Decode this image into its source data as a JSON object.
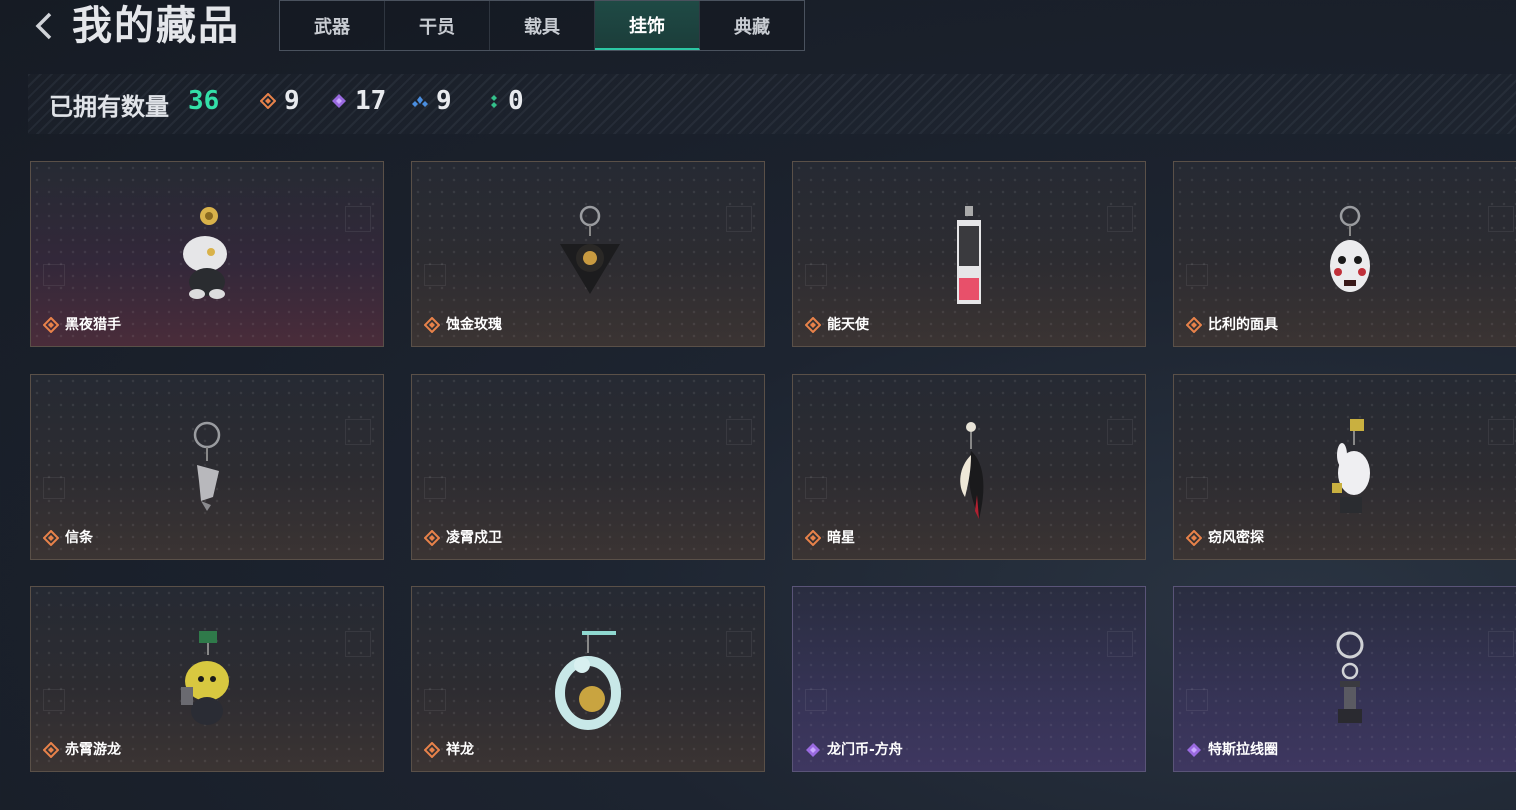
{
  "header": {
    "title": "我的藏品",
    "tabs": [
      {
        "label": "武器",
        "active": false
      },
      {
        "label": "干员",
        "active": false
      },
      {
        "label": "载具",
        "active": false
      },
      {
        "label": "挂饰",
        "active": true
      },
      {
        "label": "典藏",
        "active": false
      }
    ]
  },
  "stats": {
    "label": "已拥有数量",
    "total": "36",
    "orange_count": "9",
    "purple_count": "17",
    "blue_count": "9",
    "green_count": "0"
  },
  "colors": {
    "accent": "#33e0a8",
    "orange": "#e8824a",
    "purple": "#9a6ae0",
    "blue": "#4a8ee0",
    "green": "#33c08a"
  },
  "items": [
    {
      "name": "黑夜猎手",
      "rarity": "orange",
      "icon": "white-creature-keychain-icon"
    },
    {
      "name": "蚀金玫瑰",
      "rarity": "orange",
      "icon": "black-rose-keychain-icon"
    },
    {
      "name": "能天使",
      "rarity": "orange",
      "icon": "card-keychain-icon"
    },
    {
      "name": "比利的面具",
      "rarity": "orange",
      "icon": "mask-keychain-icon"
    },
    {
      "name": "信条",
      "rarity": "orange",
      "icon": "silver-keychain-icon"
    },
    {
      "name": "凌霄戍卫",
      "rarity": "orange",
      "icon": "guard-keychain-icon"
    },
    {
      "name": "暗星",
      "rarity": "orange",
      "icon": "feather-keychain-icon"
    },
    {
      "name": "窃风密探",
      "rarity": "orange",
      "icon": "white-bunny-keychain-icon"
    },
    {
      "name": "赤霄游龙",
      "rarity": "orange",
      "icon": "yellow-dragon-keychain-icon"
    },
    {
      "name": "祥龙",
      "rarity": "orange",
      "icon": "coiled-dragon-keychain-icon"
    },
    {
      "name": "龙门币-方舟",
      "rarity": "purple",
      "icon": "coin-keychain-icon"
    },
    {
      "name": "特斯拉线圈",
      "rarity": "purple",
      "icon": "tesla-coil-keychain-icon"
    }
  ]
}
